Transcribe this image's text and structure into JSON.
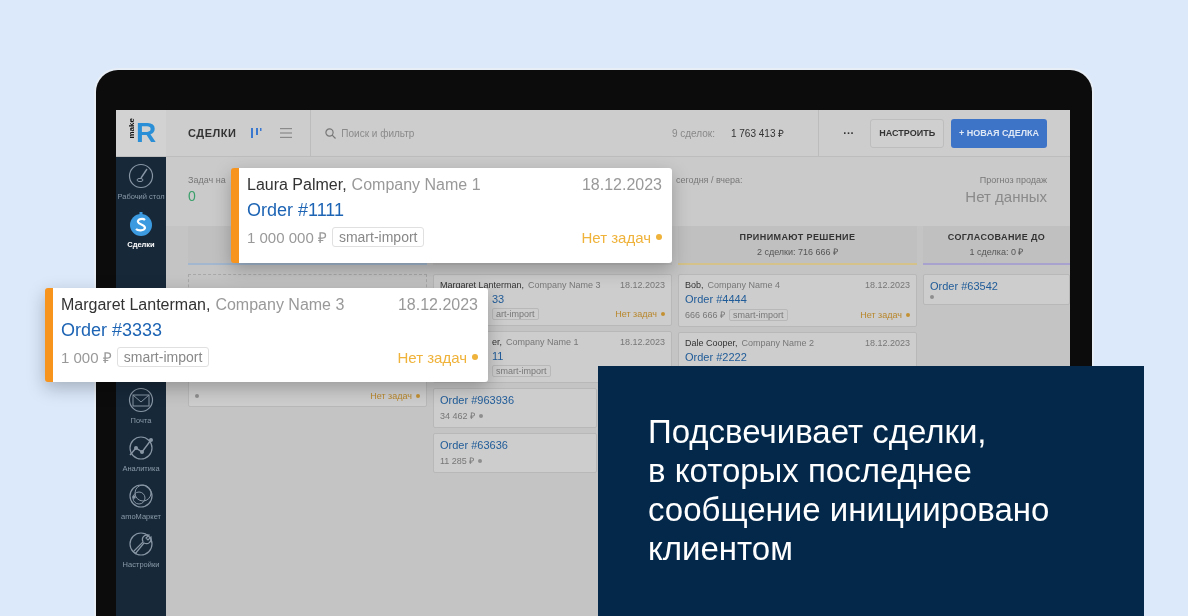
{
  "top_bar": {
    "logo": {
      "word": "make",
      "letter": "R"
    },
    "title": "СДЕЛКИ",
    "search": {
      "placeholder": "Поиск и фильтр"
    },
    "summary_label": "9 сделок:",
    "summary_value": "1 763 413 ₽",
    "more": "···",
    "settings_button": "НАСТРОИТЬ",
    "new_button": "+ НОВАЯ СДЕЛКА"
  },
  "sidebar": {
    "top_items": [
      {
        "label": "Рабочий стол",
        "selected": false
      },
      {
        "label": "Сделки",
        "selected": true
      }
    ],
    "bottom_items": [
      {
        "label": "Почта",
        "selected": false
      },
      {
        "label": "Аналитика",
        "selected": false
      },
      {
        "label": "amoМаркет",
        "selected": false
      },
      {
        "label": "Настройки",
        "selected": false
      }
    ]
  },
  "stats": [
    {
      "label": "Задач на",
      "value": "0"
    },
    {
      "label": "сегодня / вчера:"
    },
    {
      "label": "Прогноз продаж",
      "value": "Нет данных"
    }
  ],
  "columns": [
    {
      "color": "#a3b8cf",
      "cards": [
        {
          "kind": "quick-add"
        },
        {
          "kind": "tail",
          "status": "Нет задач"
        }
      ]
    },
    {
      "cards": [
        {
          "kind": "partial",
          "contact": "Margaret Lanterman,",
          "company": "Company Name 3",
          "date": "18.12.2023",
          "order": "33",
          "tag": "art-import",
          "status": "Нет задач"
        },
        {
          "kind": "covered",
          "contact": "er,",
          "company": "Company Name 1",
          "date": "18.12.2023",
          "order": "11",
          "tag": "smart-import"
        },
        {
          "kind": "plain",
          "order": "Order #963936",
          "amount": "34 462 ₽"
        },
        {
          "kind": "plain",
          "order": "Order #63636",
          "amount": "11 285 ₽"
        }
      ]
    },
    {
      "title": "ПРИНИМАЮТ РЕШЕНИЕ",
      "subtitle": "2 сделки: 716 666 ₽",
      "color": "#d4c28a",
      "cards": [
        {
          "kind": "full",
          "contact": "Bob,",
          "company": "Company Name 4",
          "date": "18.12.2023",
          "order": "Order #4444",
          "amount": "666 666 ₽",
          "tag": "smart-import",
          "status": "Нет задач"
        },
        {
          "kind": "full",
          "contact": "Dale Cooper,",
          "company": "Company Name 2",
          "date": "18.12.2023",
          "order": "Order #2222"
        }
      ]
    },
    {
      "title": "СОГЛАСОВАНИЕ ДО",
      "subtitle": "1 сделка: 0 ₽",
      "color": "#a8a2cf",
      "cards": [
        {
          "kind": "plain",
          "order": "Order #63542"
        }
      ]
    }
  ],
  "highlighted_cards": [
    {
      "contact": "Laura Palmer,",
      "company": "Company Name 1",
      "date": "18.12.2023",
      "order": "Order #1111",
      "amount": "1 000 000 ₽",
      "tag": "smart-import",
      "status": "Нет задач"
    },
    {
      "contact": "Margaret Lanterman,",
      "company": "Company Name 3",
      "date": "18.12.2023",
      "order": "Order #3333",
      "amount": "1 000 ₽",
      "tag": "smart-import",
      "status": "Нет задач"
    }
  ],
  "banner": {
    "text": "Подсвечивает сделки,\nв которых последнее\nсообщение инициировано\nклиентом"
  }
}
